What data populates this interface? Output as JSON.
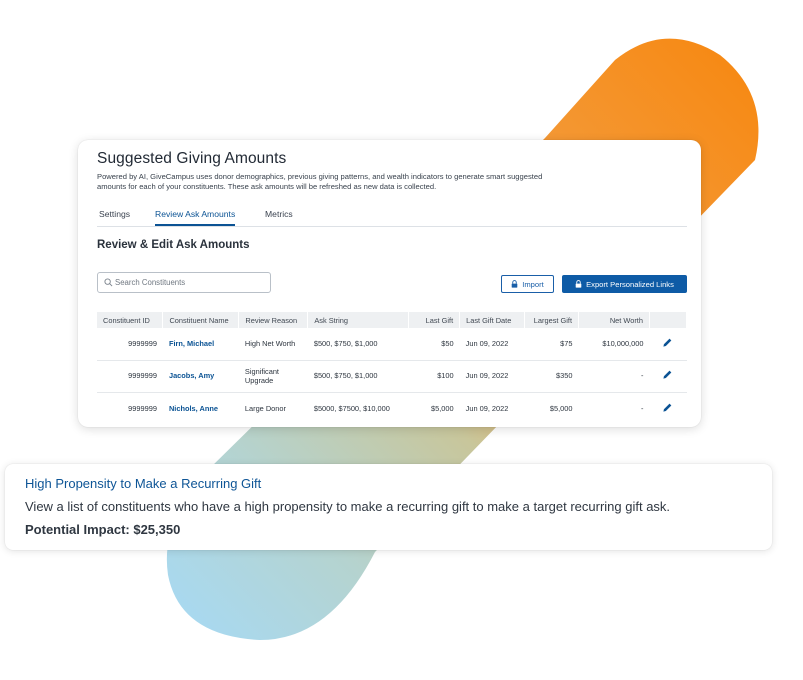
{
  "colors": {
    "accent": "#0b5394",
    "button_primary": "#0e5ba6",
    "orange": "#f7941d",
    "olive": "#c9c79a",
    "light_blue": "#a8daf5"
  },
  "card": {
    "title": "Suggested Giving Amounts",
    "description": "Powered by AI, GiveCampus uses donor demographics, previous giving patterns, and wealth indicators to generate smart suggested amounts for each of your constituents. These ask amounts will be refreshed as new data is collected.",
    "tabs": [
      {
        "label": "Settings",
        "active": false
      },
      {
        "label": "Review Ask Amounts",
        "active": true
      },
      {
        "label": "Metrics",
        "active": false
      }
    ],
    "section_title": "Review & Edit Ask Amounts",
    "search": {
      "placeholder": "Search Constituents",
      "value": "",
      "icon": "search-icon"
    },
    "import_label": "Import",
    "export_label": "Export Personalized Links",
    "table": {
      "columns": [
        "Constituent ID",
        "Constituent Name",
        "Review Reason",
        "Ask String",
        "Last Gift",
        "Last Gift Date",
        "Largest Gift",
        "Net Worth",
        ""
      ],
      "rows": [
        {
          "id": "9999999",
          "name": "Firn, Michael",
          "reason": "High Net Worth",
          "ask": "$500, $750, $1,000",
          "last_gift": "$50",
          "last_gift_date": "Jun 09, 2022",
          "largest_gift": "$75",
          "net_worth": "$10,000,000"
        },
        {
          "id": "9999999",
          "name": "Jacobs, Amy",
          "reason": "Significant Upgrade",
          "ask": "$500, $750, $1,000",
          "last_gift": "$100",
          "last_gift_date": "Jun 09, 2022",
          "largest_gift": "$350",
          "net_worth": "-"
        },
        {
          "id": "9999999",
          "name": "Nichols, Anne",
          "reason": "Large Donor",
          "ask": "$5000, $7500, $10,000",
          "last_gift": "$5,000",
          "last_gift_date": "Jun 09, 2022",
          "largest_gift": "$5,000",
          "net_worth": "-"
        }
      ]
    }
  },
  "insight": {
    "title": "High Propensity to Make a Recurring Gift",
    "description": "View a list of constituents who have a high propensity to make a recurring gift to make a target recurring gift ask.",
    "impact": "Potential Impact: $25,350"
  }
}
